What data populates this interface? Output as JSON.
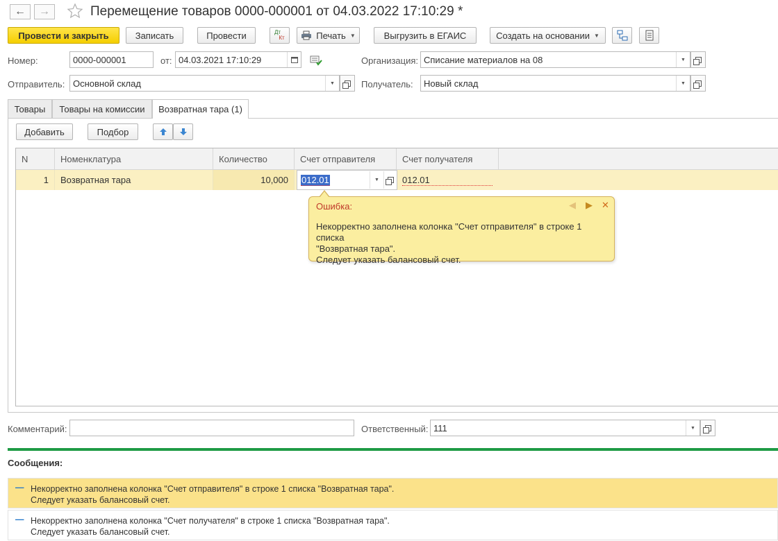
{
  "window": {
    "title": "Перемещение товаров 0000-000001 от 04.03.2022 17:10:29 *"
  },
  "toolbar": {
    "post_close": "Провести и закрыть",
    "save": "Записать",
    "post": "Провести",
    "dtkt_top": "Дт",
    "dtkt_bottom": "Кт",
    "print": "Печать",
    "export": "Выгрузить в ЕГАИС",
    "create_based": "Создать на основании"
  },
  "form": {
    "number_label": "Номер:",
    "number_value": "0000-000001",
    "date_label": "от:",
    "date_value": "04.03.2021 17:10:29",
    "org_label": "Организация:",
    "org_value": "Списание материалов на 08",
    "sender_label": "Отправитель:",
    "sender_value": "Основной склад",
    "receiver_label": "Получатель:",
    "receiver_value": "Новый склад",
    "comment_label": "Комментарий:",
    "comment_value": "",
    "responsible_label": "Ответственный:",
    "responsible_value": "111"
  },
  "tabs": [
    {
      "label": "Товары"
    },
    {
      "label": "Товары на комиссии"
    },
    {
      "label": "Возвратная тара (1)"
    }
  ],
  "table_toolbar": {
    "add": "Добавить",
    "select": "Подбор"
  },
  "table": {
    "columns": [
      "N",
      "Номенклатура",
      "Количество",
      "Счет отправителя",
      "Счет получателя"
    ],
    "rows": [
      {
        "n": "1",
        "item": "Возвратная тара",
        "qty": "10,000",
        "sender_account": "012.01",
        "receiver_account": "012.01"
      }
    ]
  },
  "error_tip": {
    "title": "Ошибка:",
    "line1": "Некорректно заполнена колонка \"Счет отправителя\" в строке 1 списка",
    "line2": "\"Возвратная тара\".",
    "line3": "Следует указать балансовый счет."
  },
  "messages": {
    "title": "Сообщения:",
    "items": [
      {
        "line1": "Некорректно заполнена колонка \"Счет отправителя\" в строке 1 списка \"Возвратная тара\".",
        "line2": "Следует указать балансовый счет.",
        "highlighted": true
      },
      {
        "line1": "Некорректно заполнена колонка \"Счет получателя\" в строке 1 списка \"Возвратная тара\".",
        "line2": "Следует указать балансовый счет.",
        "highlighted": false
      }
    ]
  },
  "colors": {
    "primary_button": "#f5cf00",
    "selected_row": "#fbf0c2",
    "error_tooltip": "#fbeea0",
    "message_highlight": "#fbe28a",
    "separator_green": "#1f9b45",
    "selection_blue": "#3b6cc9"
  }
}
